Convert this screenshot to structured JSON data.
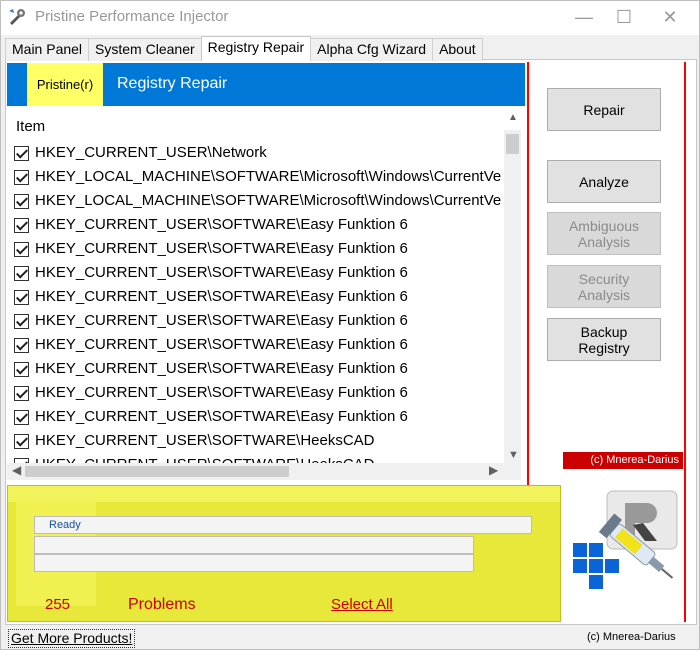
{
  "window": {
    "title": "Pristine Performance Injector",
    "controls": {
      "minimize": "—",
      "maximize": "☐",
      "close": "✕"
    }
  },
  "tabs": [
    {
      "label": "Main Panel",
      "active": false
    },
    {
      "label": "System Cleaner",
      "active": false
    },
    {
      "label": "Registry Repair",
      "active": true
    },
    {
      "label": "Alpha Cfg Wizard",
      "active": false
    },
    {
      "label": "About",
      "active": false
    }
  ],
  "header": {
    "badge": "Pristine(r)",
    "title": "Registry Repair",
    "color": "#0078d7",
    "badge_color": "#ffff66"
  },
  "list": {
    "column_header": "Item",
    "rows": [
      {
        "checked": true,
        "text": "HKEY_CURRENT_USER\\Network"
      },
      {
        "checked": true,
        "text": "HKEY_LOCAL_MACHINE\\SOFTWARE\\Microsoft\\Windows\\CurrentVe"
      },
      {
        "checked": true,
        "text": "HKEY_LOCAL_MACHINE\\SOFTWARE\\Microsoft\\Windows\\CurrentVe"
      },
      {
        "checked": true,
        "text": "HKEY_CURRENT_USER\\SOFTWARE\\Easy Funktion 6"
      },
      {
        "checked": true,
        "text": "HKEY_CURRENT_USER\\SOFTWARE\\Easy Funktion 6"
      },
      {
        "checked": true,
        "text": "HKEY_CURRENT_USER\\SOFTWARE\\Easy Funktion 6"
      },
      {
        "checked": true,
        "text": "HKEY_CURRENT_USER\\SOFTWARE\\Easy Funktion 6"
      },
      {
        "checked": true,
        "text": "HKEY_CURRENT_USER\\SOFTWARE\\Easy Funktion 6"
      },
      {
        "checked": true,
        "text": "HKEY_CURRENT_USER\\SOFTWARE\\Easy Funktion 6"
      },
      {
        "checked": true,
        "text": "HKEY_CURRENT_USER\\SOFTWARE\\Easy Funktion 6"
      },
      {
        "checked": true,
        "text": "HKEY_CURRENT_USER\\SOFTWARE\\Easy Funktion 6"
      },
      {
        "checked": true,
        "text": "HKEY_CURRENT_USER\\SOFTWARE\\Easy Funktion 6"
      },
      {
        "checked": true,
        "text": "HKEY_CURRENT_USER\\SOFTWARE\\HeeksCAD"
      },
      {
        "checked": true,
        "text": "HKEY_CURRENT_USER\\SOFTWARE\\HeeksCAD"
      }
    ]
  },
  "actions": {
    "repair": "Repair",
    "analyze": "Analyze",
    "ambiguous": "Ambiguous Analysis",
    "security": "Security Analysis",
    "backup": "Backup Registry"
  },
  "right_copyright": "(c) Mnerea-Darius",
  "status": {
    "message": "Ready",
    "count": "255",
    "problems_label": "Problems",
    "select_all": "Select All",
    "accent_red": "#cc0000",
    "yellow": "#e8e83a"
  },
  "footer": {
    "link": "Get More Products!",
    "copyright": "(c) Mnerea-Darius"
  },
  "icons": {
    "app": "wrench-app-icon",
    "logo": "syringe-registry-logo"
  }
}
